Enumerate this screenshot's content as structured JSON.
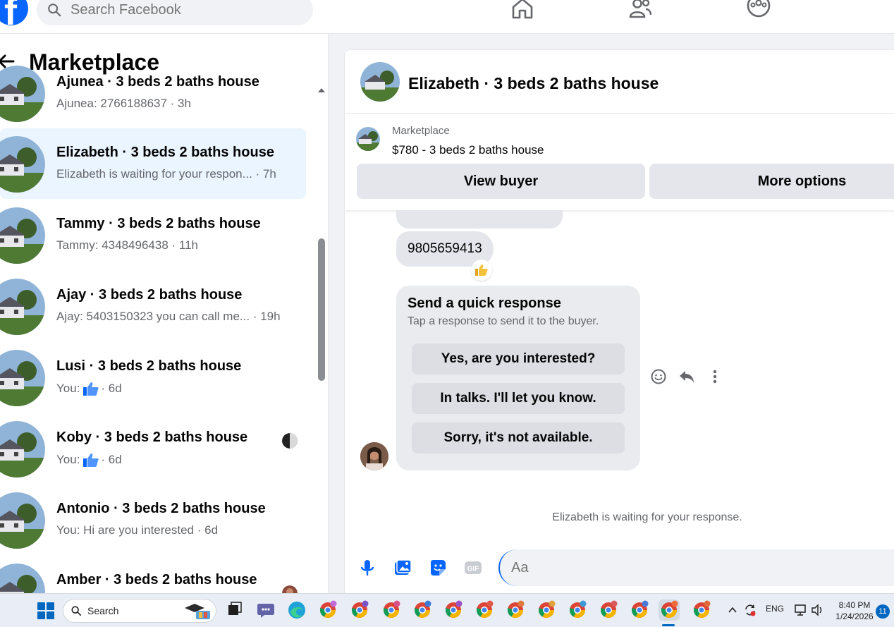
{
  "topbar": {
    "search_placeholder": "Search Facebook",
    "icons": [
      "facebook-logo-icon",
      "search-icon",
      "home-icon",
      "friends-icon",
      "groups-icon"
    ]
  },
  "left_panel": {
    "title": "Marketplace",
    "conversations": [
      {
        "name": "Ajunea · 3 beds 2 baths house",
        "preview": "Ajunea: 2766188637",
        "time": "· 3h",
        "active": false,
        "like": false
      },
      {
        "name": "Elizabeth · 3 beds 2 baths house",
        "preview": "Elizabeth is waiting for your respon...",
        "time": "· 7h",
        "active": true,
        "like": false
      },
      {
        "name": "Tammy · 3 beds 2 baths house",
        "preview": "Tammy: 4348496438",
        "time": "· 11h",
        "active": false,
        "like": false
      },
      {
        "name": "Ajay · 3 beds 2 baths house",
        "preview": "Ajay: 5403150323 you can call me...",
        "time": "· 19h",
        "active": false,
        "like": false
      },
      {
        "name": "Lusi · 3 beds 2 baths house",
        "preview": "You:",
        "time": "· 6d",
        "active": false,
        "like": true
      },
      {
        "name": "Koby · 3 beds 2 baths house",
        "preview": "You:",
        "time": "· 6d",
        "active": false,
        "like": true
      },
      {
        "name": "Antonio · 3 beds 2 baths house",
        "preview": "You: Hi are you interested",
        "time": "· 6d",
        "active": false,
        "like": false
      },
      {
        "name": "Amber · 3 beds 2 baths house",
        "preview": "",
        "time": "",
        "active": false,
        "like": false
      }
    ]
  },
  "chat": {
    "header_title": "Elizabeth · 3 beds 2 baths house",
    "listing_kind": "Marketplace",
    "listing_title": "$780 - 3 beds 2 baths house",
    "view_buyer_label": "View buyer",
    "more_options_label": "More options",
    "phone_message": "9805659413",
    "quick_title": "Send a quick response",
    "quick_sub": "Tap a response to send it to the buyer.",
    "quick_responses": [
      "Yes, are you interested?",
      "In talks. I'll let you know.",
      "Sorry, it's not available."
    ],
    "waiting_note": "Elizabeth is waiting for your response.",
    "composer_placeholder": "Aa"
  },
  "taskbar": {
    "search_label": "Search",
    "language": "ENG",
    "time": "8:40 PM",
    "date": "1/24/2026",
    "notification_count": "11"
  },
  "colors": {
    "facebook_blue": "#0866ff",
    "active_row": "#ebf5ff",
    "button_gray": "#e4e6eb",
    "secondary_text": "#65676b"
  }
}
